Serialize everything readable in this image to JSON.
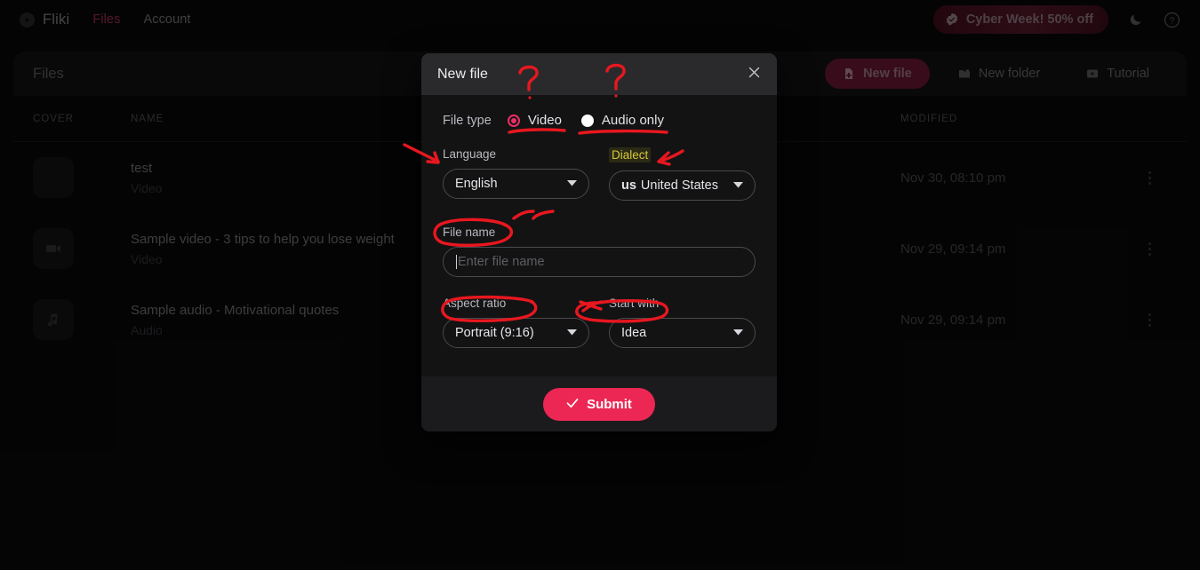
{
  "nav": {
    "brand": "Fliki",
    "brand_icon": "fliki-play-badge-icon",
    "links": [
      {
        "label": "Files",
        "active": true
      },
      {
        "label": "Account",
        "active": false
      }
    ],
    "promo": {
      "label": "Cyber Week! 50% off",
      "icon": "verified-badge-icon",
      "color": "#641c30"
    },
    "theme_toggle_icon": "moon-icon",
    "help_icon": "question-circle-icon"
  },
  "files_header": {
    "title": "Files",
    "actions": [
      {
        "label": "New file",
        "icon": "file-plus-icon",
        "primary": true
      },
      {
        "label": "New folder",
        "icon": "folder-plus-icon",
        "primary": false
      },
      {
        "label": "Tutorial",
        "icon": "play-rect-icon",
        "primary": false
      }
    ]
  },
  "table": {
    "columns": [
      "COVER",
      "NAME",
      "MODIFIED"
    ],
    "rows": [
      {
        "thumb_icon": "blank-thumb-icon",
        "name": "test",
        "type": "Video",
        "modified": "Nov 30, 08:10 pm"
      },
      {
        "thumb_icon": "video-camera-icon",
        "name": "Sample video - 3 tips to help you lose weight",
        "type": "Video",
        "modified": "Nov 29, 09:14 pm"
      },
      {
        "thumb_icon": "music-note-icon",
        "name": "Sample audio - Motivational quotes",
        "type": "Audio",
        "modified": "Nov 29, 09:14 pm"
      }
    ],
    "row_menu_icon": "more-vertical-icon"
  },
  "modal": {
    "title": "New file",
    "close_icon": "close-icon",
    "file_type": {
      "label": "File type",
      "options": [
        {
          "label": "Video",
          "selected": true
        },
        {
          "label": "Audio only",
          "selected": false
        }
      ]
    },
    "language": {
      "label": "Language",
      "value": "English",
      "caret_icon": "chevron-down-icon"
    },
    "dialect": {
      "label": "Dialect",
      "flag": "us",
      "value": "United States",
      "caret_icon": "chevron-down-icon",
      "highlight_color": "#d4c93a"
    },
    "file_name": {
      "label": "File name",
      "value": "",
      "placeholder": "Enter file name"
    },
    "aspect_ratio": {
      "label": "Aspect ratio",
      "value": "Portrait (9:16)",
      "caret_icon": "chevron-down-icon"
    },
    "start_with": {
      "label": "Start with",
      "value": "Idea",
      "caret_icon": "chevron-down-icon"
    },
    "submit": {
      "label": "Submit",
      "icon": "check-icon",
      "color": "#ec2754"
    }
  },
  "annotations": {
    "color": "#e8171f",
    "marks": [
      {
        "kind": "question-mark",
        "near": "modal-title-right"
      },
      {
        "kind": "question-mark",
        "near": "modal-header-center"
      },
      {
        "kind": "underline",
        "near": "video-radio-label"
      },
      {
        "kind": "underline",
        "near": "audio-only-radio-label"
      },
      {
        "kind": "arrow",
        "near": "language-label"
      },
      {
        "kind": "arrow",
        "near": "dialect-label"
      },
      {
        "kind": "circle",
        "near": "file-name-label"
      },
      {
        "kind": "arrow",
        "near": "file-name-label-top"
      },
      {
        "kind": "circle",
        "near": "aspect-ratio-label"
      },
      {
        "kind": "circle",
        "near": "start-with-label"
      },
      {
        "kind": "arrow",
        "near": "start-with-label-left"
      }
    ]
  }
}
